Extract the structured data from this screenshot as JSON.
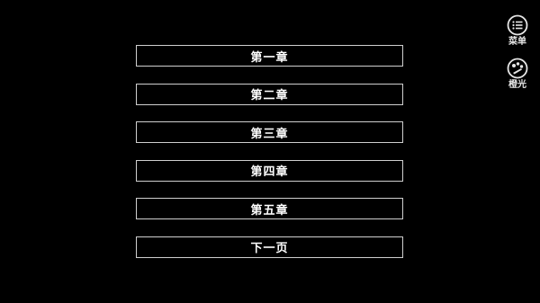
{
  "chapters": [
    {
      "label": "第一章"
    },
    {
      "label": "第二章"
    },
    {
      "label": "第三章"
    },
    {
      "label": "第四章"
    },
    {
      "label": "第五章"
    },
    {
      "label": "下一页"
    }
  ],
  "tools": {
    "menu": {
      "label": "菜单",
      "icon": "list-icon"
    },
    "brightness": {
      "label": "橙光",
      "icon": "palette-icon"
    }
  },
  "colors": {
    "background": "#000000",
    "border": "#cfcfcf",
    "text": "#ffffff"
  }
}
